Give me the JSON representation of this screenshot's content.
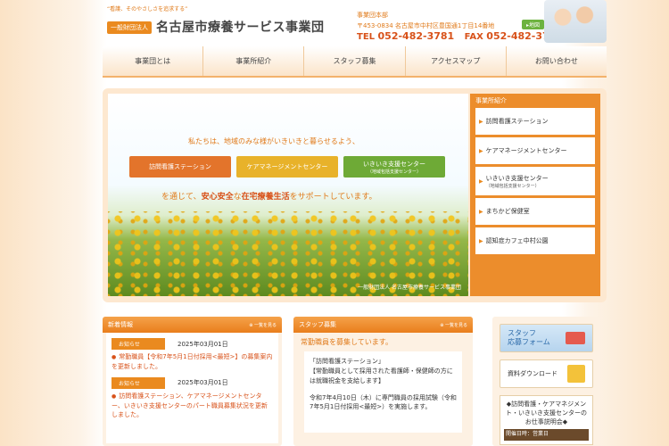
{
  "header": {
    "tagline": "“看護、そのやさしさを追求する”",
    "badge": "一般財団法人",
    "org_name": "名古屋市療養サービス事業団",
    "office_label": "事業団本部",
    "address": "〒453-0834 名古屋市中村区豊国通1丁目14番地",
    "map_label": "▸地図",
    "tel_label": "TEL",
    "tel": "052-482-3781",
    "fax_label": "FAX",
    "fax": "052-482-3785"
  },
  "nav": [
    {
      "label": "事業団とは"
    },
    {
      "label": "事業所紹介"
    },
    {
      "label": "スタッフ募集"
    },
    {
      "label": "アクセスマップ"
    },
    {
      "label": "お問い合わせ"
    }
  ],
  "hero": {
    "lead": "私たちは、地域のみな様がいきいきと暮らせるよう、",
    "buttons": [
      {
        "label": "訪問看護ステーション",
        "sub": ""
      },
      {
        "label": "ケアマネージメントセンター",
        "sub": ""
      },
      {
        "label": "いきいき支援センター",
        "sub": "（地域包括支援センター）"
      }
    ],
    "sub_prefix": "を通じて、",
    "sub_em1": "安心安全",
    "sub_mid": "な",
    "sub_em2": "在宅療養生活",
    "sub_suffix": "をサポートしています。",
    "caption": "一般財団法人 名古屋市療養サービス事業団"
  },
  "offices": {
    "title": "事業所紹介",
    "items": [
      {
        "label": "訪問看護ステーション",
        "sub": ""
      },
      {
        "label": "ケアマネージメントセンター",
        "sub": ""
      },
      {
        "label": "いきいき支援センター",
        "sub": "（地域包括支援センター）"
      },
      {
        "label": "まちかど保健室",
        "sub": ""
      },
      {
        "label": "認知症カフェ中村公園",
        "sub": ""
      }
    ]
  },
  "news": {
    "title": "新着情報",
    "more": "⊕ 一覧を見る",
    "items": [
      {
        "tag": "お知らせ",
        "date": "2025年03月01日",
        "text": "常勤職員【令和7年5月1日付採用<最短>】の募集案内を更新しました。"
      },
      {
        "tag": "お知らせ",
        "date": "2025年03月01日",
        "text": "訪問看護ステーション、ケアマネージメントセンター、いきいき支援センターのパート職員募集状況を更新しました。"
      }
    ]
  },
  "staff": {
    "title": "スタッフ募集",
    "more": "⊕ 一覧を見る",
    "lead": "常勤職員を募集しています。",
    "heading": "「訪問看護ステーション」",
    "text1": "【常勤職員として採用された看護師・保健師の方には就職祝金を支給します】",
    "text2": "令和7年4月10日（木）に専門職員の採用試験（令和7年5月1日付採用<最短>）を実施します。"
  },
  "side": {
    "recruit_line1": "スタッフ",
    "recruit_line2": "応募フォーム",
    "download_label": "資料ダウンロード",
    "info": "◆訪問看護・ケアマネジメント・いきいき支援センターのお仕事説明会◆",
    "hours": "開催日時：営業日"
  }
}
